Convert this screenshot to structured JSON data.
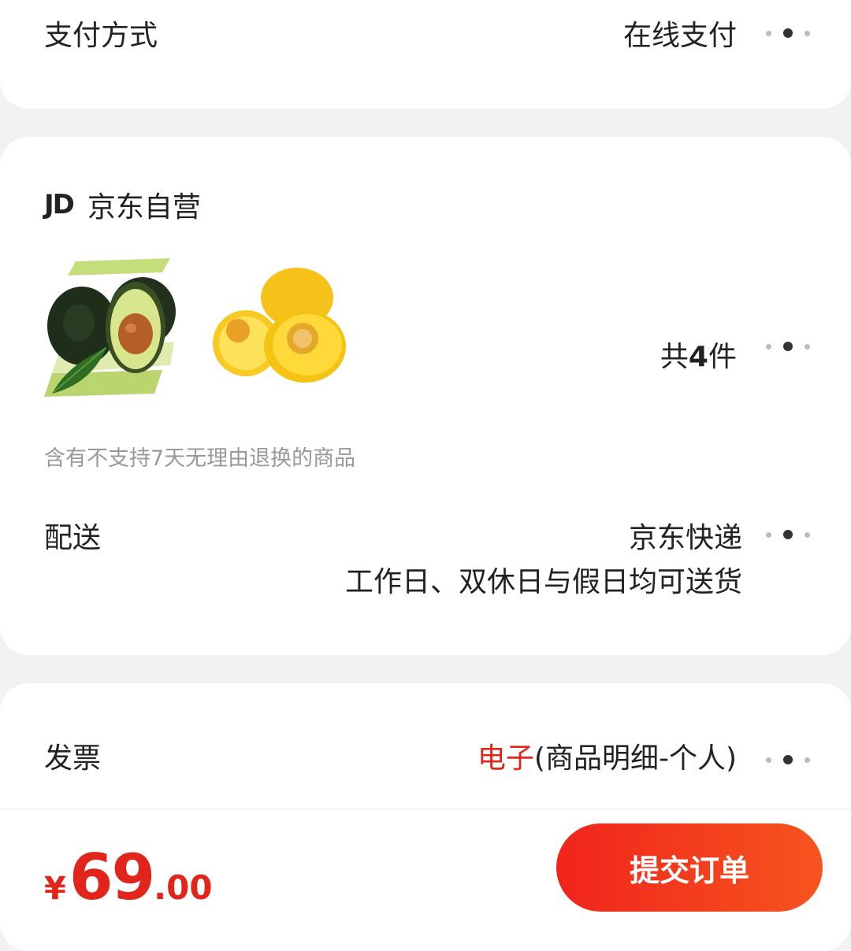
{
  "payment": {
    "label": "支付方式",
    "value": "在线支付"
  },
  "shop": {
    "logo": "JD",
    "name": "京东自营",
    "products": [
      {
        "name": "avocado"
      },
      {
        "name": "yellow peach"
      }
    ],
    "count_prefix": "共",
    "count_number": "4",
    "count_suffix": "件",
    "notice": "含有不支持7天无理由退换的商品",
    "delivery": {
      "label": "配送",
      "method": "京东快递",
      "time": "工作日、双休日与假日均可送货"
    }
  },
  "invoice": {
    "label": "发票",
    "type": "电子",
    "detail": "(商品明细-个人)"
  },
  "footer": {
    "currency": "¥",
    "price_int": "69",
    "price_dec": ".00",
    "submit": "提交订单"
  },
  "colors": {
    "accent": "#e1251b",
    "button_start": "#f0241c",
    "button_end": "#f6551e"
  },
  "icons": {
    "more": "dots-more-icon"
  }
}
